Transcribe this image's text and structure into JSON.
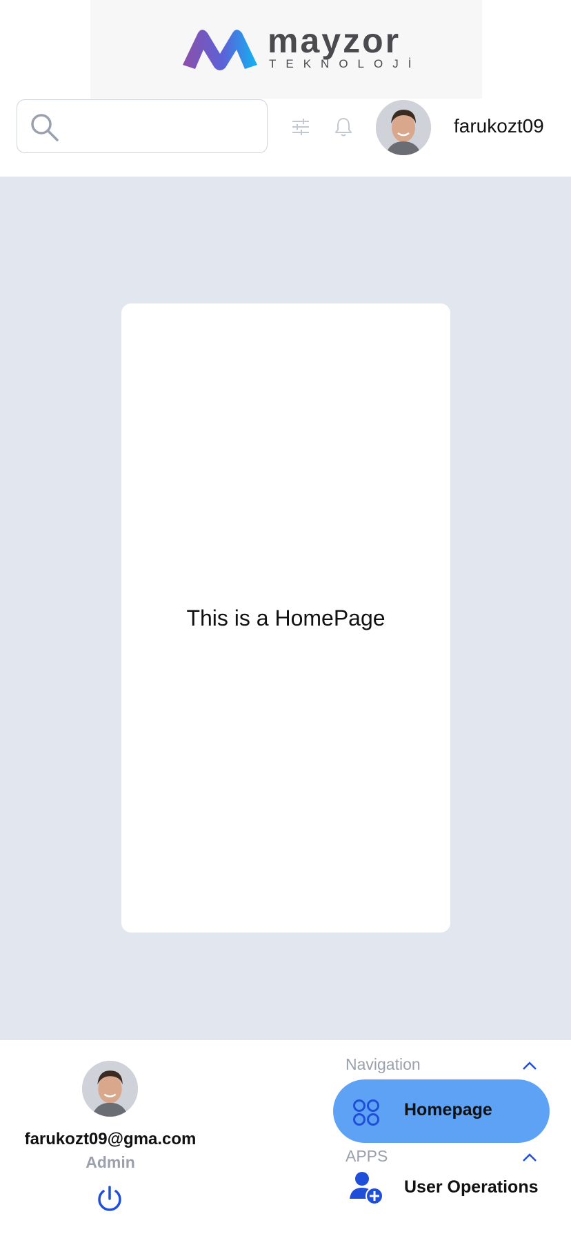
{
  "brand": {
    "name": "mayzor",
    "sub": "TEKNOLOJİ",
    "colors": {
      "purple": "#7b4fa9",
      "cyan": "#19a6f0",
      "text": "#4a4a4f"
    }
  },
  "header": {
    "search": {
      "placeholder": "",
      "value": ""
    },
    "icons": [
      "search-icon",
      "filter-sliders-icon",
      "bell-icon"
    ],
    "username": "farukozt09"
  },
  "main": {
    "card_text": "This is a HomePage",
    "background": "#e2e7ef"
  },
  "profile": {
    "email": "farukozt09@gma.com",
    "role": "Admin",
    "logout_icon": "power-icon"
  },
  "sidebar": {
    "sections": [
      {
        "title": "Navigation",
        "expanded": true,
        "items": [
          {
            "label": "Homepage",
            "icon": "grid-circles-icon",
            "active": true
          }
        ]
      },
      {
        "title": "APPS",
        "expanded": true,
        "items": [
          {
            "label": "User Operations",
            "icon": "add-user-icon",
            "active": false
          }
        ]
      }
    ],
    "accent": "#5ea2f6",
    "icon_color": "#1f4fd8"
  }
}
